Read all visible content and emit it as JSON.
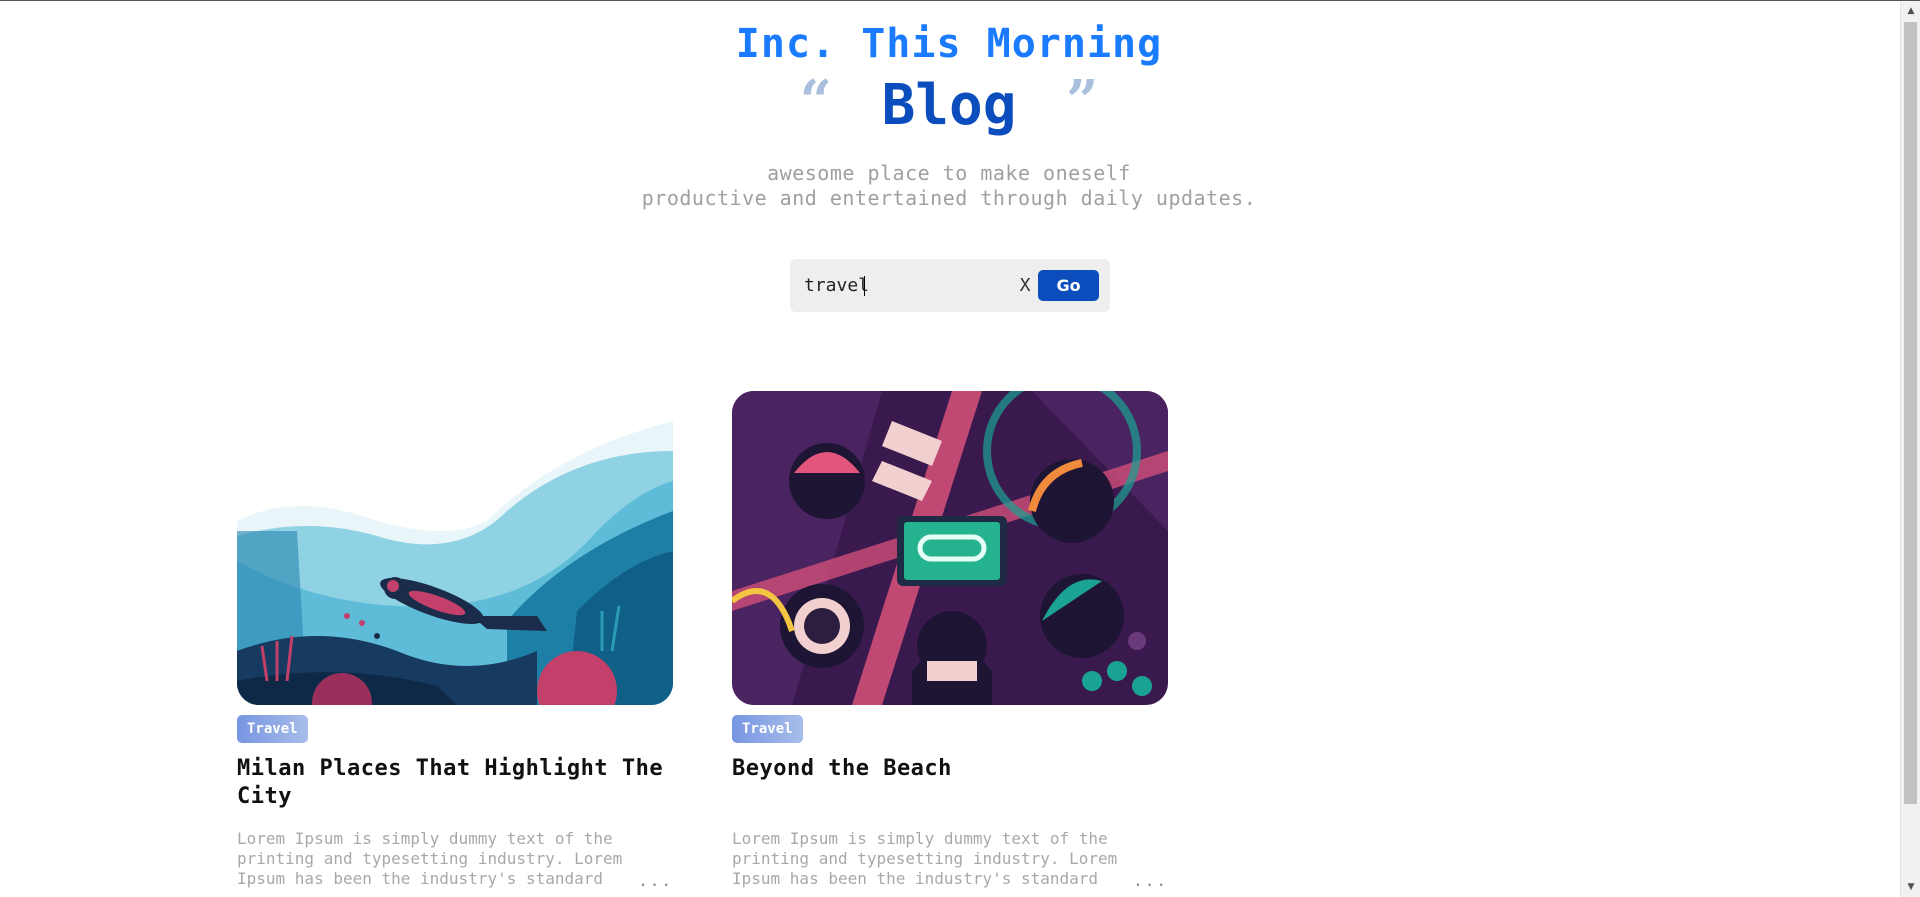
{
  "header": {
    "brand": "Inc. This Morning",
    "open_quote": "“",
    "blog_title": "Blog",
    "close_quote": "”",
    "tagline_line1": "awesome place to make oneself",
    "tagline_line2": "productive and entertained through daily updates."
  },
  "search": {
    "value": "travel",
    "clear_label": "X",
    "go_label": "Go"
  },
  "posts": [
    {
      "category": "Travel",
      "title": "Milan Places That Highlight The City",
      "excerpt": "Lorem Ipsum is simply dummy text of the printing and typesetting industry. Lorem Ipsum has been the industry's standard",
      "more": "..."
    },
    {
      "category": "Travel",
      "title": "Beyond the Beach",
      "excerpt": "Lorem Ipsum is simply dummy text of the printing and typesetting industry. Lorem Ipsum has been the industry's standard",
      "more": "..."
    }
  ],
  "colors": {
    "brand": "#1b7bff",
    "blog_title": "#0b4dbd",
    "button": "#0b4dbd",
    "badge": "#7796e2"
  },
  "icons": {
    "scroll_up": "arrow-up-icon",
    "scroll_down": "arrow-down-icon"
  }
}
